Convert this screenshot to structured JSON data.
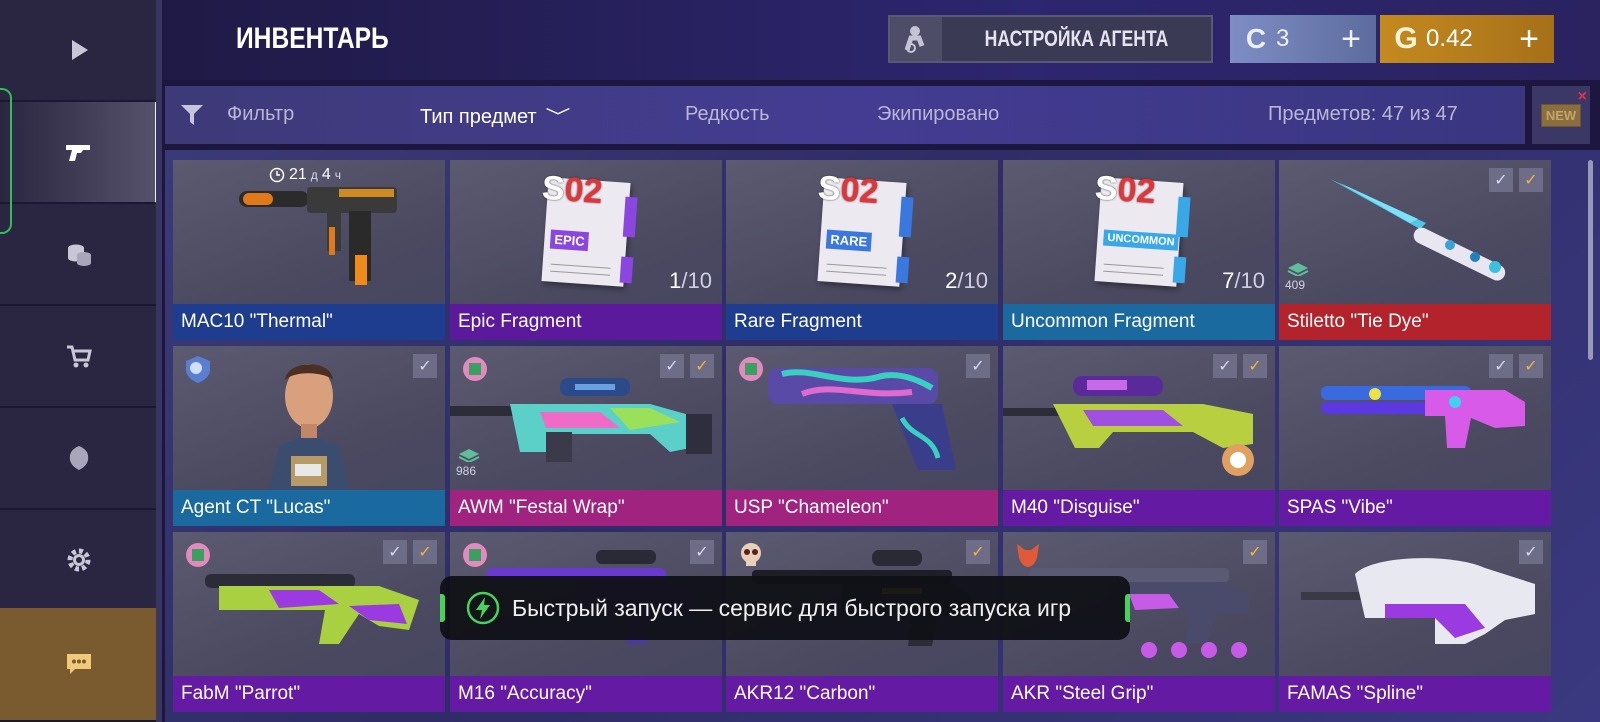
{
  "header": {
    "title": "ИНВЕНТАРЬ",
    "agent_button": "НАСТРОЙКА АГЕНТА",
    "silver": {
      "symbol": "C",
      "value": "3",
      "plus": "+"
    },
    "gold": {
      "symbol": "G",
      "value": "0.42",
      "plus": "+"
    }
  },
  "sidebar": {
    "items": [
      {
        "icon": "play-icon"
      },
      {
        "icon": "pistol-icon",
        "active": true
      },
      {
        "icon": "coins-icon"
      },
      {
        "icon": "cart-icon"
      },
      {
        "icon": "emblem-icon"
      },
      {
        "icon": "gear-icon"
      },
      {
        "icon": "chat-icon"
      }
    ]
  },
  "filterbar": {
    "filter": "Фильтр",
    "type": "Тип предмет",
    "rarity": "Редкость",
    "equipped": "Экипировано",
    "count": "Предметов: 47 из 47",
    "new_badge": "NEW"
  },
  "items": [
    {
      "name": "MAC10 \"Thermal\"",
      "rarity": "blue",
      "timer": "21",
      "timer_u1": "д",
      "timer_h": "4",
      "timer_u2": "ч"
    },
    {
      "name": "Epic Fragment",
      "rarity": "purple",
      "tier": "EPIC",
      "count": "1",
      "max": "10",
      "s_prefix": "S",
      "s_suffix": "02"
    },
    {
      "name": "Rare Fragment",
      "rarity": "blue",
      "tier": "RARE",
      "count": "2",
      "max": "10",
      "s_prefix": "S",
      "s_suffix": "02"
    },
    {
      "name": "Uncommon Fragment",
      "rarity": "cyan",
      "tier": "UNCOMMON",
      "count": "7",
      "max": "10",
      "s_prefix": "S",
      "s_suffix": "02"
    },
    {
      "name": "Stiletto \"Tie Dye\"",
      "rarity": "red",
      "stack": "409"
    },
    {
      "name": "Agent CT \"Lucas\"",
      "rarity": "cyan"
    },
    {
      "name": "AWM \"Festal Wrap\"",
      "rarity": "magenta",
      "stack": "986"
    },
    {
      "name": "USP \"Chameleon\"",
      "rarity": "magenta"
    },
    {
      "name": "M40 \"Disguise\"",
      "rarity": "violet"
    },
    {
      "name": "SPAS \"Vibe\"",
      "rarity": "violet"
    },
    {
      "name": "FabM \"Parrot\"",
      "rarity": "violet"
    },
    {
      "name": "M16 \"Accuracy\"",
      "rarity": "violet"
    },
    {
      "name": "AKR12 \"Carbon\"",
      "rarity": "violet"
    },
    {
      "name": "AKR \"Steel Grip\"",
      "rarity": "violet"
    },
    {
      "name": "FAMAS \"Spline\"",
      "rarity": "violet"
    }
  ],
  "toast": {
    "message": "Быстрый запуск — сервис для быстрого запуска игр"
  }
}
